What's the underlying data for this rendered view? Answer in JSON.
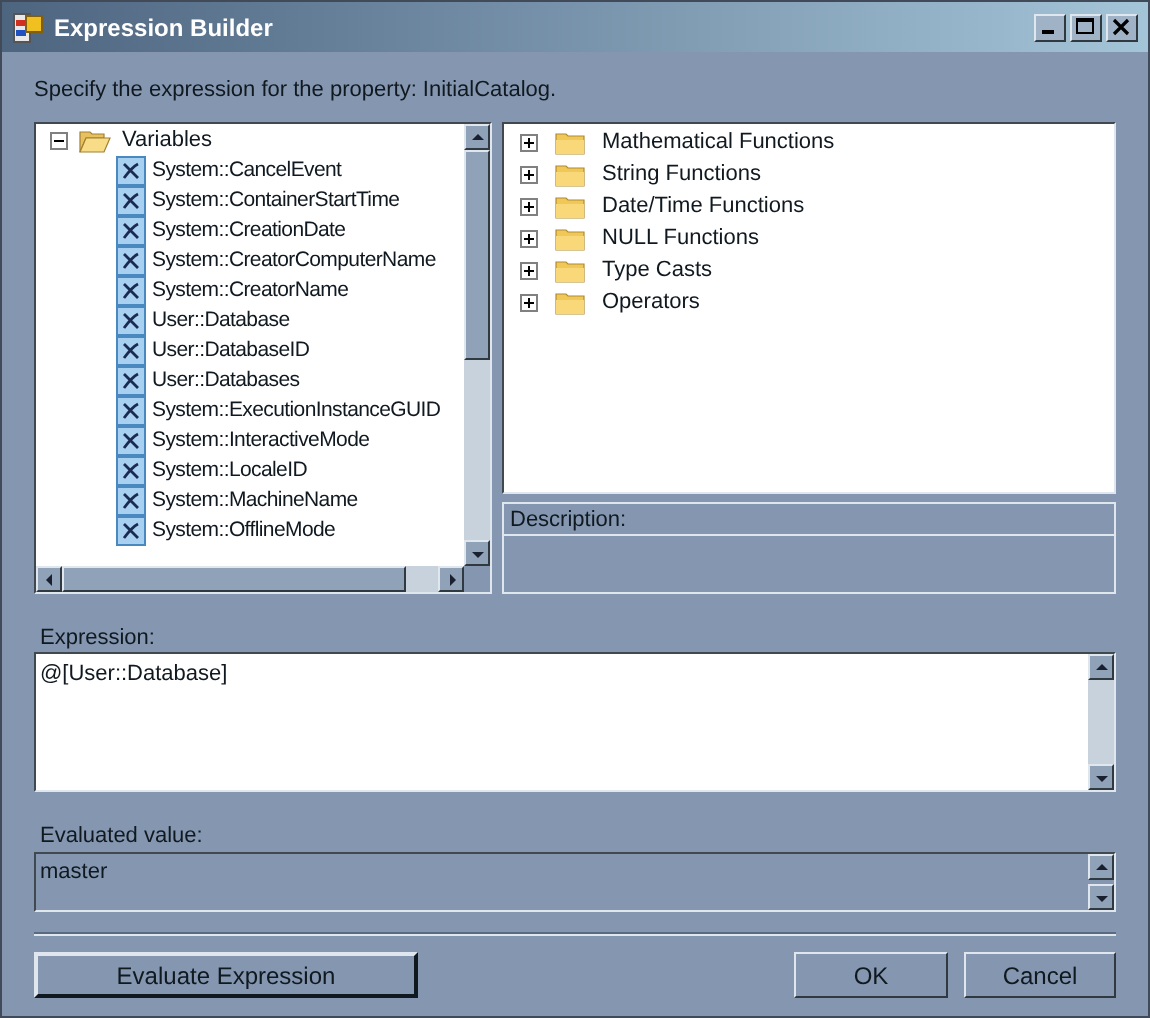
{
  "window": {
    "title": "Expression Builder"
  },
  "instruction": "Specify the expression for the property: InitialCatalog.",
  "variables_tree": [
    {
      "label": "Variables",
      "expanded": true,
      "children": [
        {
          "label": "System::CancelEvent"
        },
        {
          "label": "System::ContainerStartTime"
        },
        {
          "label": "System::CreationDate"
        },
        {
          "label": "System::CreatorComputerName"
        },
        {
          "label": "System::CreatorName"
        },
        {
          "label": "User::Database"
        },
        {
          "label": "User::DatabaseID"
        },
        {
          "label": "User::Databases"
        },
        {
          "label": "System::ExecutionInstanceGUID"
        },
        {
          "label": "System::InteractiveMode"
        },
        {
          "label": "System::LocaleID"
        },
        {
          "label": "System::MachineName"
        },
        {
          "label": "System::OfflineMode"
        }
      ]
    }
  ],
  "functions_tree": [
    {
      "label": "Mathematical Functions",
      "expanded": false
    },
    {
      "label": "String Functions",
      "expanded": false
    },
    {
      "label": "Date/Time Functions",
      "expanded": false
    },
    {
      "label": "NULL Functions",
      "expanded": false
    },
    {
      "label": "Type Casts",
      "expanded": false
    },
    {
      "label": "Operators",
      "expanded": false
    }
  ],
  "description": {
    "label": "Description:"
  },
  "expression": {
    "label": "Expression:",
    "value": "@[User::Database]"
  },
  "evaluated_value": {
    "label": "Evaluated value:",
    "value": "master"
  },
  "buttons": {
    "evaluate": "Evaluate Expression",
    "ok": "OK",
    "cancel": "Cancel"
  }
}
